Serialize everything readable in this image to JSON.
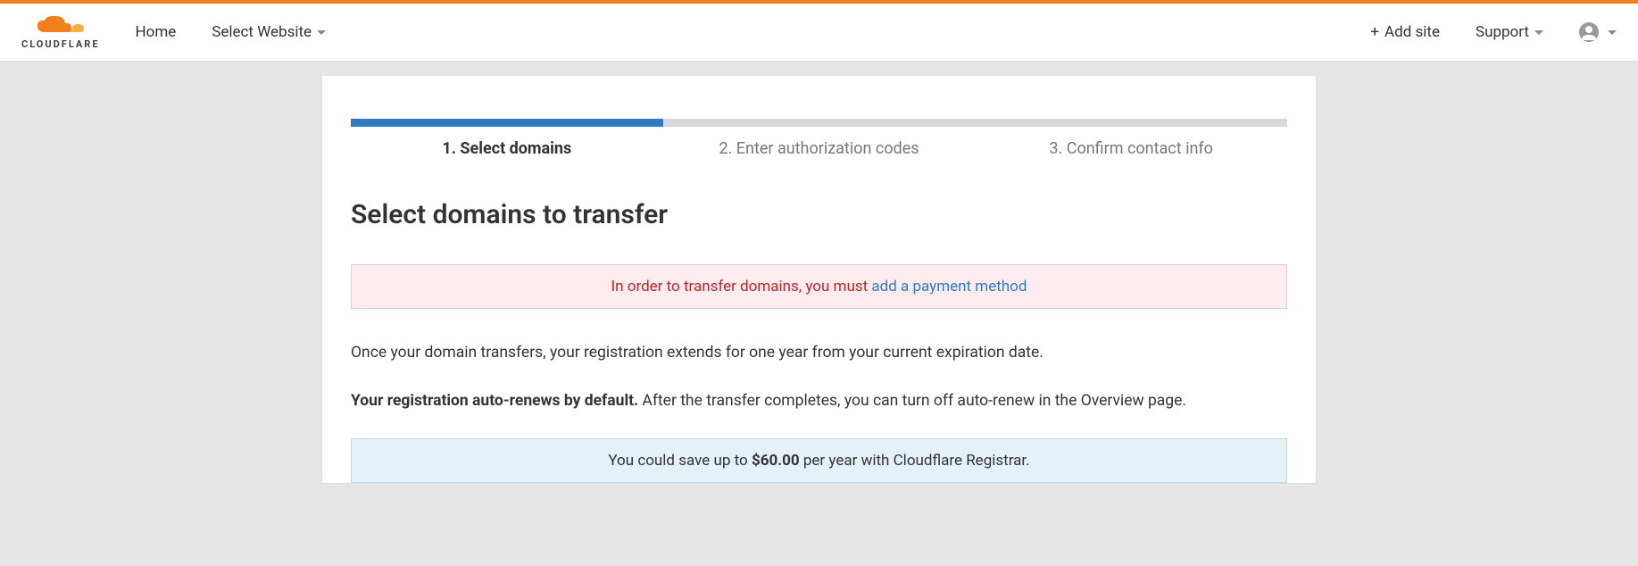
{
  "brand": {
    "name": "CLOUDFLARE"
  },
  "nav": {
    "home": "Home",
    "select_website": "Select Website",
    "add_site": "Add site",
    "support": "Support"
  },
  "steps": {
    "s1": "1. Select domains",
    "s2": "2. Enter authorization codes",
    "s3": "3. Confirm contact info"
  },
  "page": {
    "title": "Select domains to transfer",
    "alert_prefix": "In order to transfer domains, you must ",
    "alert_link": "add a payment method",
    "para1": "Once your domain transfers, your registration extends for one year from your current expiration date.",
    "para2_bold": "Your registration auto-renews by default.",
    "para2_rest": " After the transfer completes, you can turn off auto-renew in the Overview page.",
    "savings_prefix": "You could save up to ",
    "savings_amount": "$60.00",
    "savings_suffix": " per year with Cloudflare Registrar."
  }
}
